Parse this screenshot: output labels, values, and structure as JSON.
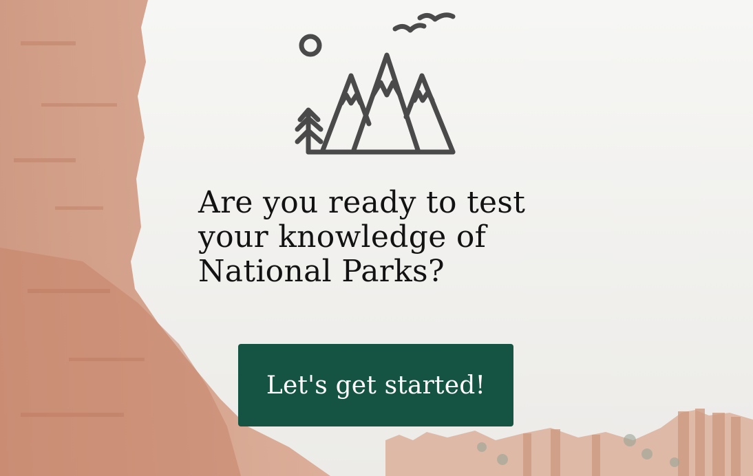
{
  "hero": {
    "headline": "Are you ready to test your knowledge of National Parks?",
    "logo_icon": "mountains-with-birds-sun-tree-icon",
    "background_image": "red-rock-canyon-hoodoos-photo"
  },
  "actions": {
    "start_label": "Let's get started!"
  },
  "colors": {
    "button_bg": "#155442",
    "button_text": "#ffffff",
    "headline_text": "#121212",
    "icon_stroke": "#4a4a4a",
    "rock": "#c47a5a",
    "overlay": "#f4f4f2"
  }
}
